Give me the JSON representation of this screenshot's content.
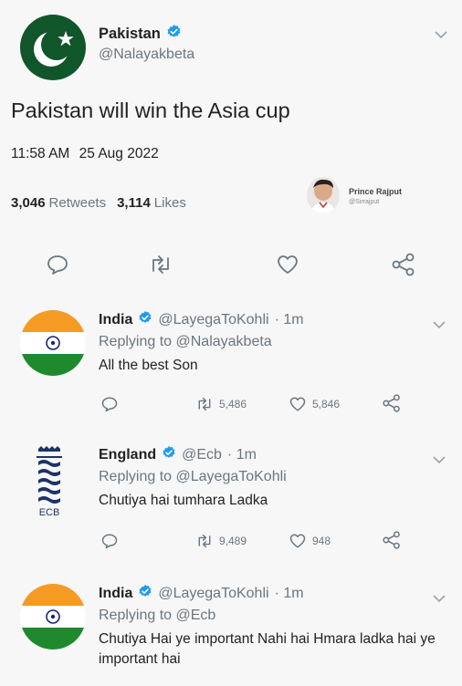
{
  "main_tweet": {
    "display_name": "Pakistan",
    "handle": "@Nalayakbeta",
    "text": "Pakistan will win the Asia cup",
    "time": "11:58 AM",
    "date": "25 Aug 2022",
    "retweets_count": "3,046",
    "retweets_label": "Retweets",
    "likes_count": "3,114",
    "likes_label": "Likes"
  },
  "watermark": {
    "name": "Prince Rajput",
    "sub": "@Sirrajput"
  },
  "replies": [
    {
      "display_name": "India",
      "handle": "@LayegaToKohli",
      "time": "· 1m",
      "replying_prefix": "Replying to",
      "replying_to": "@Nalayakbeta",
      "text": "All the best Son",
      "retweets": "5,486",
      "likes": "5,846"
    },
    {
      "display_name": "England",
      "handle": "@Ecb",
      "time": "· 1m",
      "replying_prefix": "Replying to",
      "replying_to": "@LayegaToKohli",
      "text": "Chutiya hai tumhara Ladka",
      "retweets": "9,489",
      "likes": "948"
    },
    {
      "display_name": "India",
      "handle": "@LayegaToKohli",
      "time": "· 1m",
      "replying_prefix": "Replying to",
      "replying_to": "@Ecb",
      "text": "Chutiya Hai ye important Nahi hai Hmara ladka hai ye important hai"
    }
  ],
  "colors": {
    "pakistan_green": "#11562b",
    "saffron": "#f59a23",
    "india_green": "#1f8a2d",
    "chakra_navy": "#1c2470",
    "verified_blue": "#1d9bf0",
    "gray": "#6b7680",
    "england_navy": "#1d3366"
  }
}
